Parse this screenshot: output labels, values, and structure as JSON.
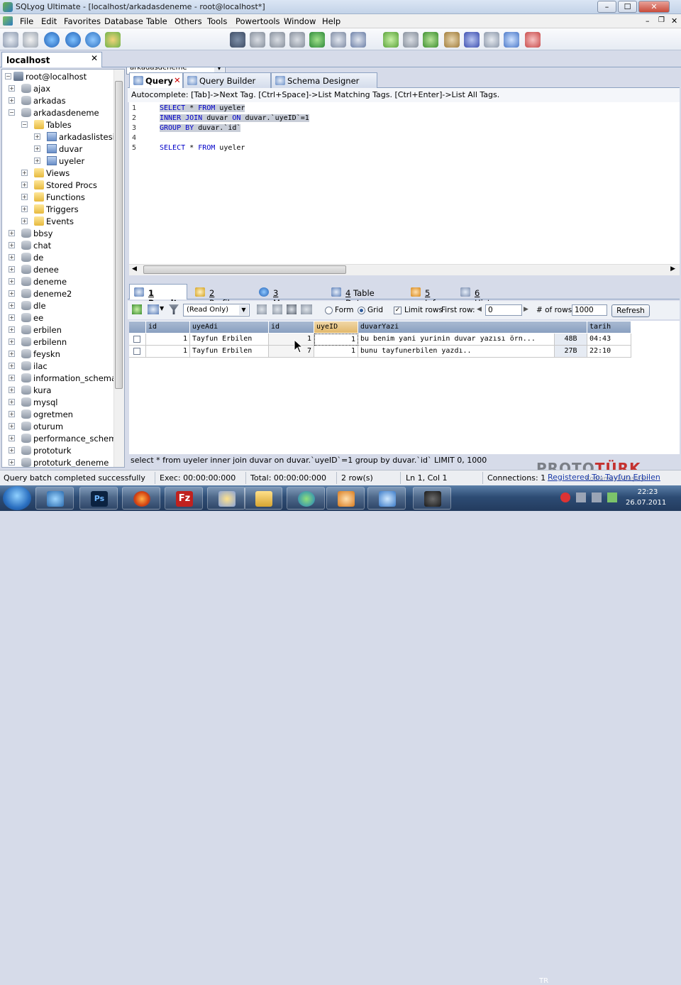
{
  "window": {
    "title": "SQLyog Ultimate - [localhost/arkadasdeneme - root@localhost*]",
    "minimize": "–",
    "maximize": "☐",
    "close": "✕"
  },
  "menu": [
    "File",
    "Edit",
    "Favorites",
    "Database",
    "Table",
    "Others",
    "Tools",
    "Powertools",
    "Window",
    "Help"
  ],
  "toolbar": {
    "database": "arkadasdeneme"
  },
  "connection_tab": {
    "label": "localhost",
    "close": "✕"
  },
  "tree": {
    "root": "root@localhost",
    "nodes": [
      {
        "label": "ajax",
        "expanded": false
      },
      {
        "label": "arkadas",
        "expanded": false
      },
      {
        "label": "arkadasdeneme",
        "expanded": true,
        "children": [
          {
            "label": "Tables",
            "tables": [
              "arkadaslistesi",
              "duvar",
              "uyeler"
            ]
          },
          {
            "label": "Views"
          },
          {
            "label": "Stored Procs"
          },
          {
            "label": "Functions"
          },
          {
            "label": "Triggers"
          },
          {
            "label": "Events"
          }
        ]
      },
      {
        "label": "bbsy"
      },
      {
        "label": "chat"
      },
      {
        "label": "de"
      },
      {
        "label": "denee"
      },
      {
        "label": "deneme"
      },
      {
        "label": "deneme2"
      },
      {
        "label": "dle"
      },
      {
        "label": "ee"
      },
      {
        "label": "erbilen"
      },
      {
        "label": "erbilenn"
      },
      {
        "label": "feyskn"
      },
      {
        "label": "ilac"
      },
      {
        "label": "information_schema"
      },
      {
        "label": "kura"
      },
      {
        "label": "mysql"
      },
      {
        "label": "ogretmen"
      },
      {
        "label": "oturum"
      },
      {
        "label": "performance_schema"
      },
      {
        "label": "prototurk"
      },
      {
        "label": "prototurk_deneme"
      }
    ]
  },
  "query_tabs": [
    {
      "label": "Query",
      "active": true
    },
    {
      "label": "Query Builder",
      "active": false
    },
    {
      "label": "Schema Designer",
      "active": false
    }
  ],
  "autocomplete": "Autocomplete: [Tab]->Next Tag. [Ctrl+Space]->List Matching Tags. [Ctrl+Enter]->List All Tags.",
  "editor": {
    "line_numbers": [
      "1",
      "2",
      "3",
      "4",
      "5"
    ],
    "lines": [
      {
        "kw1": "SELECT",
        "mid": " * ",
        "kw2": "FROM",
        "rest": " uyeler"
      },
      {
        "kw1": "INNER JOIN",
        "mid": " duvar ",
        "kw2": "ON",
        "rest": " duvar.`uyeID`=1"
      },
      {
        "kw1": "GROUP BY",
        "mid": " duvar.`id`",
        "kw2": "",
        "rest": ""
      },
      {
        "kw1": "",
        "mid": "",
        "kw2": "",
        "rest": ""
      },
      {
        "kw1": "SELECT",
        "mid": " * ",
        "kw2": "FROM",
        "rest": " uyeler"
      }
    ]
  },
  "result_tabs": [
    {
      "num": "1",
      "label": " Result",
      "active": true
    },
    {
      "num": "2",
      "label": " Profiler",
      "active": false
    },
    {
      "num": "3",
      "label": " Messages",
      "active": false
    },
    {
      "num": "4",
      "label": " Table Data",
      "active": false
    },
    {
      "num": "5",
      "label": " Info",
      "active": false
    },
    {
      "num": "6",
      "label": " History",
      "active": false
    }
  ],
  "result_toolbar": {
    "mode": "(Read Only)",
    "form": "Form",
    "grid": "Grid",
    "limit_rows": "Limit rows",
    "first_row_label": "First row:",
    "first_row": "0",
    "rows_label": "# of rows:",
    "rows": "1000",
    "refresh": "Refresh"
  },
  "grid": {
    "columns": [
      "id",
      "uyeAdi",
      "id",
      "uyeID",
      "duvarYazi",
      "tarih"
    ],
    "rows": [
      [
        "1",
        "Tayfun Erbilen",
        "1",
        "1",
        "bu benim yani yurinin duvar yazısı örn...",
        "48B",
        "04:43"
      ],
      [
        "1",
        "Tayfun Erbilen",
        "7",
        "1",
        "bunu tayfunerbilen yazdı..",
        "27B",
        "22:10"
      ]
    ]
  },
  "executed_sql": "select * from uyeler inner join duvar on duvar.`uyeID`=1 group by duvar.`id` LIMIT 0, 1000",
  "status": {
    "message": "Query batch completed successfully",
    "exec": "Exec: 00:00:00:000",
    "total": "Total: 00:00:00:000",
    "rows": "2 row(s)",
    "position": "Ln 1, Col 1",
    "connections": "Connections: 1",
    "registered": "Registered To: Tayfun Erbilen"
  },
  "watermark": {
    "proto": "PROTO",
    "turk": "TÜRK",
    "sub": "Kodlamaya Başlayın"
  },
  "taskbar": {
    "lang": "TR",
    "time": "22:23",
    "date": "26.07.2011"
  },
  "colors": {
    "selection": "#c9ced8",
    "keyword": "#0000c8",
    "grid_header": "#8aa0c0"
  }
}
